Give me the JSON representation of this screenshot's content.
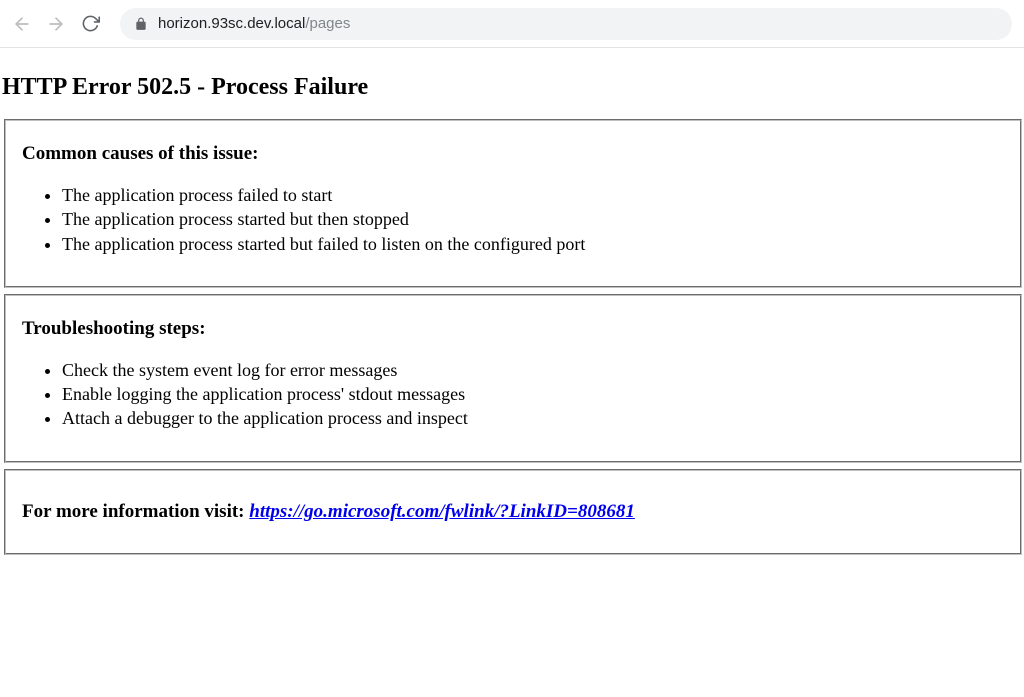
{
  "browser": {
    "url_host": "horizon.93sc.dev.local",
    "url_path": "/pages"
  },
  "page": {
    "title": "HTTP Error 502.5 - Process Failure",
    "sections": {
      "causes": {
        "heading": "Common causes of this issue:",
        "items": [
          "The application process failed to start",
          "The application process started but then stopped",
          "The application process started but failed to listen on the configured port"
        ]
      },
      "troubleshooting": {
        "heading": "Troubleshooting steps:",
        "items": [
          "Check the system event log for error messages",
          "Enable logging the application process' stdout messages",
          "Attach a debugger to the application process and inspect"
        ]
      },
      "more_info": {
        "prefix": "For more information visit: ",
        "link_text": "https://go.microsoft.com/fwlink/?LinkID=808681"
      }
    }
  }
}
